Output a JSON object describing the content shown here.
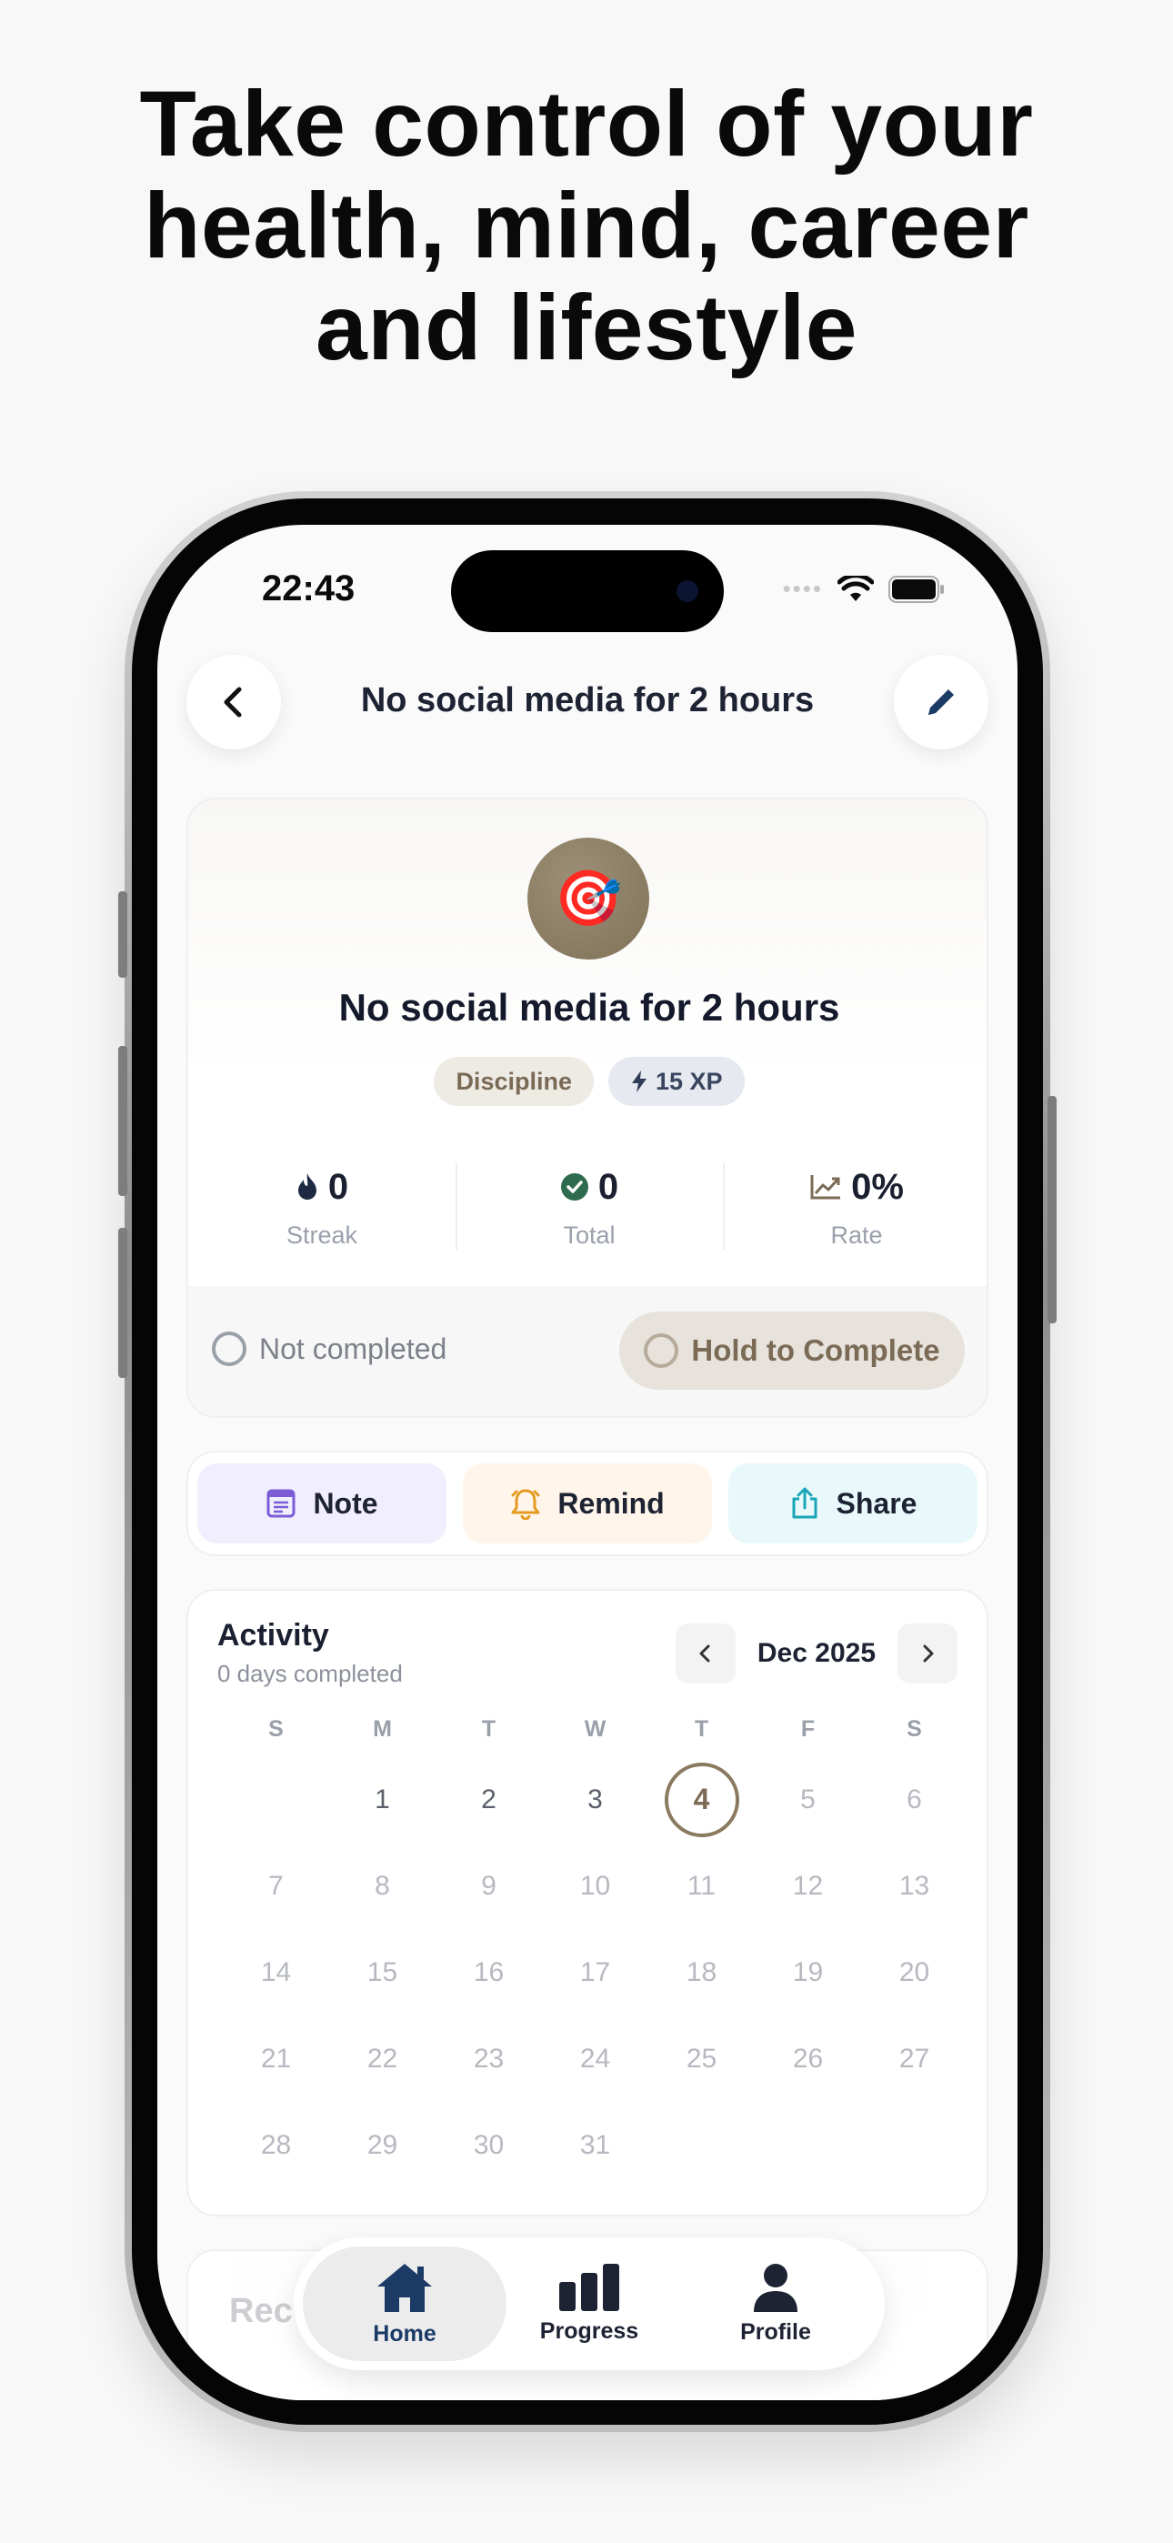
{
  "headline": {
    "line1": "Take control of your",
    "line2": "health, mind, career",
    "line3": "and lifestyle"
  },
  "status_bar": {
    "time": "22:43"
  },
  "nav": {
    "title": "No social media for 2 hours"
  },
  "habit": {
    "emoji": "🎯",
    "title": "No social media for 2 hours",
    "category": "Discipline",
    "xp": "15 XP"
  },
  "stats": [
    {
      "value": "0",
      "label": "Streak",
      "icon": "flame-icon"
    },
    {
      "value": "0",
      "label": "Total",
      "icon": "check-circle-icon"
    },
    {
      "value": "0%",
      "label": "Rate",
      "icon": "trend-chart-icon"
    }
  ],
  "completion": {
    "status": "Not completed",
    "button": "Hold to Complete"
  },
  "actions": {
    "note": "Note",
    "remind": "Remind",
    "share": "Share"
  },
  "activity": {
    "title": "Activity",
    "subtitle": "0 days completed",
    "month": "Dec 2025",
    "weekdays": [
      "S",
      "M",
      "T",
      "W",
      "T",
      "F",
      "S"
    ],
    "days": [
      "1",
      "2",
      "3",
      "4",
      "5",
      "6",
      "7",
      "8",
      "9",
      "10",
      "11",
      "12",
      "13",
      "14",
      "15",
      "16",
      "17",
      "18",
      "19",
      "20",
      "21",
      "22",
      "23",
      "24",
      "25",
      "26",
      "27",
      "28",
      "29",
      "30",
      "31"
    ],
    "today": "4"
  },
  "faded_section": {
    "label": "Rec"
  },
  "tabbar": {
    "home": "Home",
    "progress": "Progress",
    "profile": "Profile"
  },
  "colors": {
    "accent_brown": "#7b6b56",
    "navy": "#1b3a66",
    "streak_flame": "#1e2a44",
    "check_green": "#2f6b4f"
  }
}
